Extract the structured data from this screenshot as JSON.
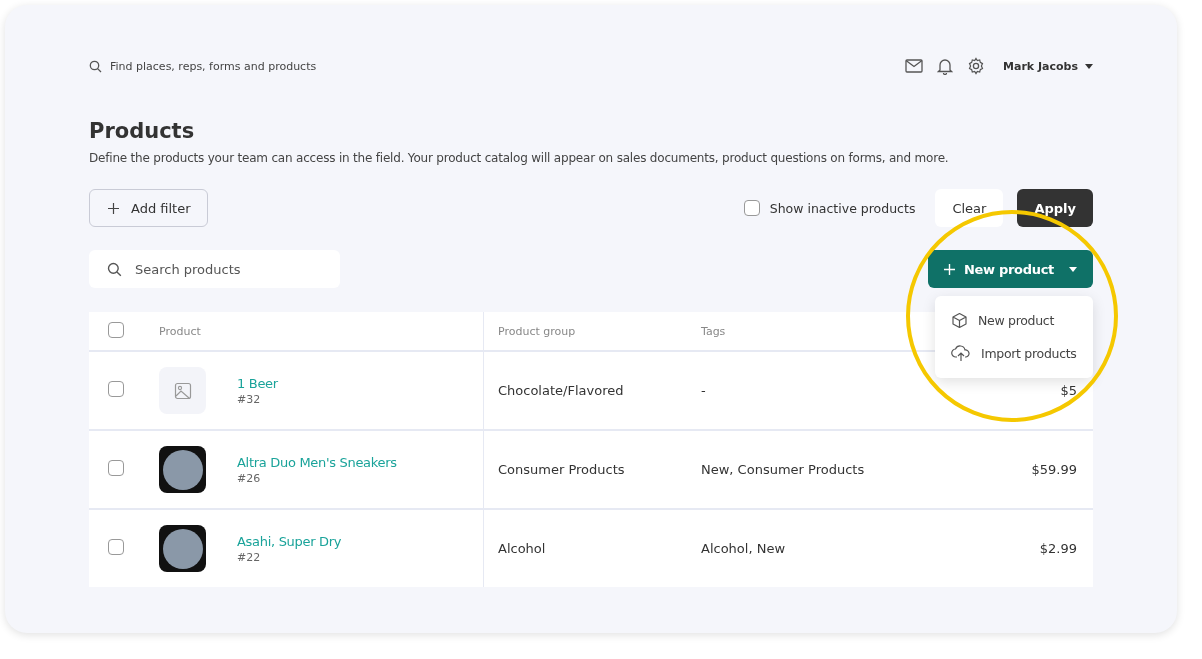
{
  "top_bar": {
    "search": {
      "placeholder": "Find places, reps, forms and products"
    },
    "user": {
      "name": "Mark Jacobs"
    }
  },
  "page": {
    "title": "Products",
    "description": "Define the products your team can access in the field. Your product catalog will appear on sales documents, product questions on forms, and more."
  },
  "filters": {
    "add_filter": "Add filter",
    "show_inactive": {
      "label": "Show inactive products",
      "checked": false
    },
    "clear": "Clear",
    "apply": "Apply"
  },
  "search": {
    "placeholder": "Search products"
  },
  "new_product": {
    "label": "New product",
    "expanded": true,
    "menu": [
      {
        "kind": "box",
        "label": "New product"
      },
      {
        "kind": "upload",
        "label": "Import products"
      }
    ]
  },
  "table": {
    "columns": [
      "Product",
      "Product group",
      "Tags"
    ],
    "header_checked": false,
    "rows": [
      {
        "checked": false,
        "kind": "placeholder",
        "name": "1 Beer",
        "number": "#32",
        "group": "Chocolate/Flavored",
        "tags": "-",
        "price": "$5"
      },
      {
        "checked": false,
        "kind": "photo",
        "name": "Altra Duo Men's Sneakers",
        "number": "#26",
        "group": "Consumer Products",
        "tags": "New, Consumer Products",
        "price": "$59.99"
      },
      {
        "checked": false,
        "kind": "photo",
        "name": "Asahi, Super Dry",
        "number": "#22",
        "group": "Alcohol",
        "tags": "Alcohol, New",
        "price": "$2.99"
      }
    ]
  }
}
